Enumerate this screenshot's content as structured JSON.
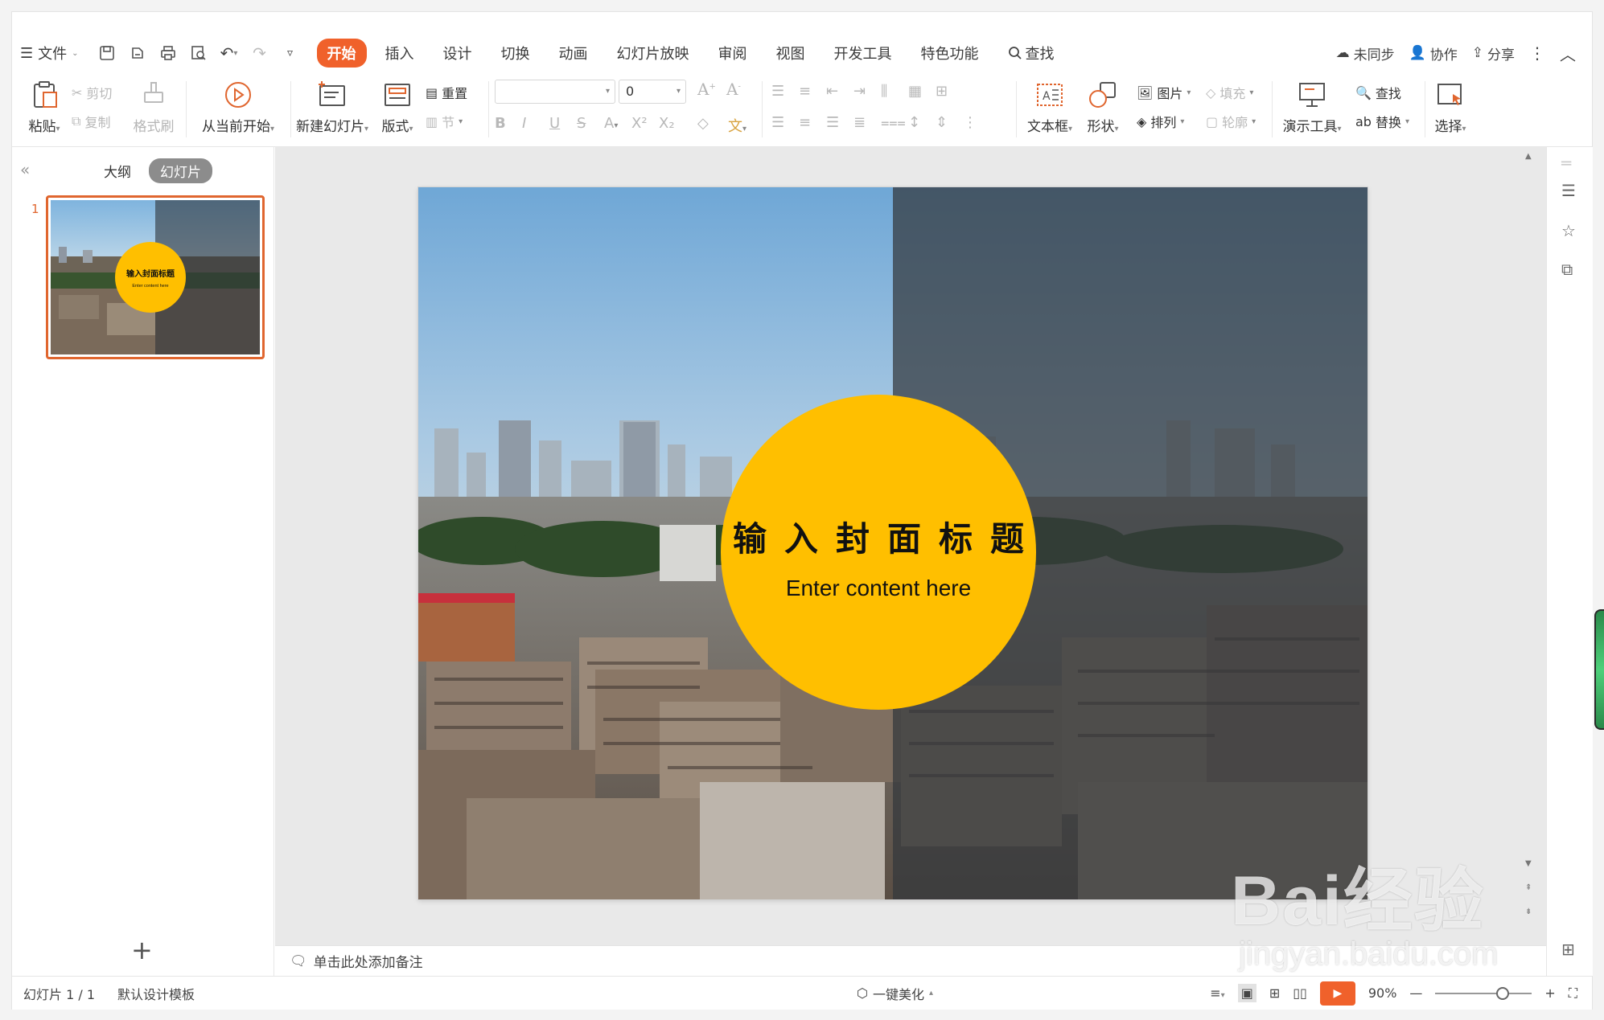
{
  "menubar": {
    "file_label": "文件",
    "tabs": [
      "开始",
      "插入",
      "设计",
      "切换",
      "动画",
      "幻灯片放映",
      "审阅",
      "视图",
      "开发工具",
      "特色功能"
    ],
    "active_tab": "开始",
    "search_label": "查找",
    "sync_label": "未同步",
    "collab_label": "协作",
    "share_label": "分享"
  },
  "ribbon": {
    "paste": "粘贴",
    "cut": "剪切",
    "copy": "复制",
    "format_painter": "格式刷",
    "play_from_current": "从当前开始",
    "new_slide": "新建幻灯片",
    "layout": "版式",
    "reset": "重置",
    "section": "节",
    "font_name": "",
    "font_size": "0",
    "textbox": "文本框",
    "shape": "形状",
    "picture": "图片",
    "fill": "填充",
    "arrange": "排列",
    "outline": "轮廓",
    "presenter_tools": "演示工具",
    "find": "查找",
    "replace": "替换",
    "select": "选择"
  },
  "leftpanel": {
    "tab_outline": "大纲",
    "tab_slides": "幻灯片",
    "active_view": "幻灯片",
    "slide_number": "1",
    "thumb_title": "输入封面标题",
    "thumb_sub": "Enter content here"
  },
  "slide": {
    "title": "输入封面标题",
    "subtitle": "Enter content here",
    "circle_color": "#FFBF00"
  },
  "notes": {
    "placeholder": "单击此处添加备注"
  },
  "statusbar": {
    "slide_info": "幻灯片 1 / 1",
    "template": "默认设计模板",
    "beautify": "一键美化",
    "zoom": "90%"
  },
  "watermark": {
    "brand": "Bai经验",
    "url": "jingyan.baidu.com"
  },
  "colors": {
    "accent": "#F0612B",
    "slide_circle": "#FFBF00"
  }
}
